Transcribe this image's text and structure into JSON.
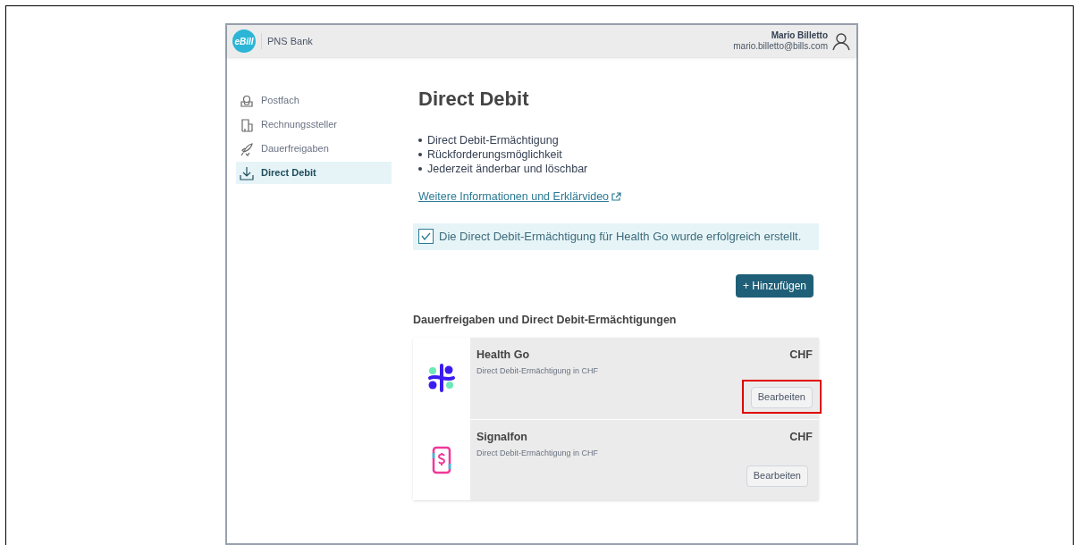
{
  "header": {
    "logo": "eBill",
    "bank": "PNS Bank",
    "user_name": "Mario Billetto",
    "user_email": "mario.billetto@bills.com"
  },
  "sidebar": {
    "items": [
      {
        "label": "Postfach",
        "selected": false
      },
      {
        "label": "Rechnungssteller",
        "selected": false
      },
      {
        "label": "Dauerfreigaben",
        "selected": false
      },
      {
        "label": "Direct Debit",
        "selected": true
      }
    ]
  },
  "main": {
    "title": "Direct Debit",
    "bullets": [
      "Direct Debit-Ermächtigung",
      "Rückforderungsmöglichkeit",
      "Jederzeit änderbar und löschbar"
    ],
    "link": "Weitere Informationen und Erklärvideo",
    "alert": {
      "checked": true,
      "text": "Die Direct Debit-Ermächtigung für Health Go wurde erfolgreich erstellt."
    },
    "add_button": "+ Hinzufügen",
    "section_title": "Dauerfreigaben und Direct Debit-Ermächtigungen",
    "mandates": [
      {
        "name": "Health Go",
        "description": "Direct Debit-Ermächtigung in CHF",
        "currency": "CHF",
        "button": "Bearbeiten",
        "highlighted": true
      },
      {
        "name": "Signalfon",
        "description": "Direct Debit-Ermächtigung in CHF",
        "currency": "CHF",
        "button": "Bearbeiten",
        "highlighted": false
      }
    ]
  }
}
